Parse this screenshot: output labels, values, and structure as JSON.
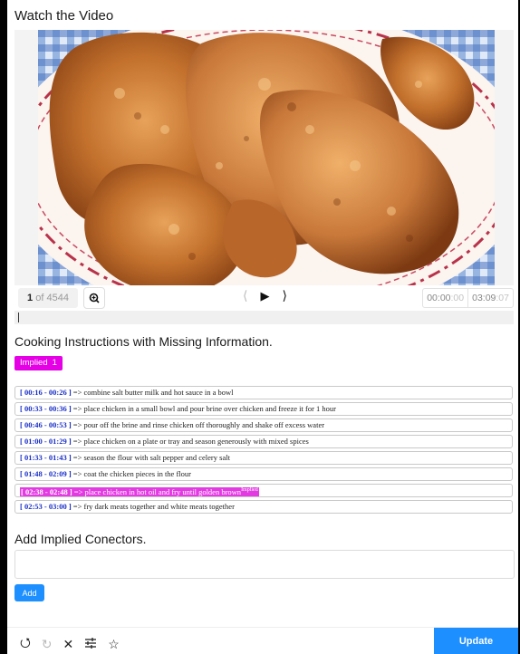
{
  "header": {
    "title": "Watch the Video"
  },
  "player": {
    "frame_current": "1",
    "frame_of": "of 4544",
    "time_current_main": "00:00",
    "time_current_frac": ":00",
    "time_total_main": "03:09",
    "time_total_frac": ":07"
  },
  "instructions": {
    "title": "Cooking Instructions with Missing Information.",
    "tag_label": "Implied",
    "tag_count": "1",
    "steps": [
      {
        "time": "[ 00:16 - 00:26 ]",
        "arrow": " => ",
        "text": "combine salt butter milk and hot sauce in a bowl"
      },
      {
        "time": "[ 00:33 - 00:36 ]",
        "arrow": " => ",
        "text": "place chicken in a small bowl and pour brine over chicken and freeze it for 1 hour"
      },
      {
        "time": "[ 00:46 - 00:53 ]",
        "arrow": " => ",
        "text": "pour off the brine and rinse chicken off thoroughly and shake off excess water"
      },
      {
        "time": "[ 01:00 - 01:29 ]",
        "arrow": " => ",
        "text": "place chicken on a plate or tray and season generously with mixed spices"
      },
      {
        "time": "[ 01:33 - 01:43 ]",
        "arrow": " => ",
        "text": "season the flour with salt pepper and celery salt"
      },
      {
        "time": "[ 01:48 - 02:09 ]",
        "arrow": " => ",
        "text": "coat the chicken pieces in the flour"
      },
      {
        "time": "[ 02:38 - 02:48 ]",
        "arrow": " => ",
        "text": "place chicken in hot oil and fry until golden brown",
        "tag": "Implied"
      },
      {
        "time": "[ 02:53 - 03:00 ]",
        "arrow": " => ",
        "text": "fry dark meats together and white meats together"
      }
    ]
  },
  "connectors": {
    "title": "Add Implied Conectors.",
    "input_value": "",
    "add_label": "Add"
  },
  "footer": {
    "update_label": "Update"
  },
  "colors": {
    "accent": "#1d8fff",
    "highlight": "#e23be2",
    "timestamp": "#1a2fc7"
  }
}
